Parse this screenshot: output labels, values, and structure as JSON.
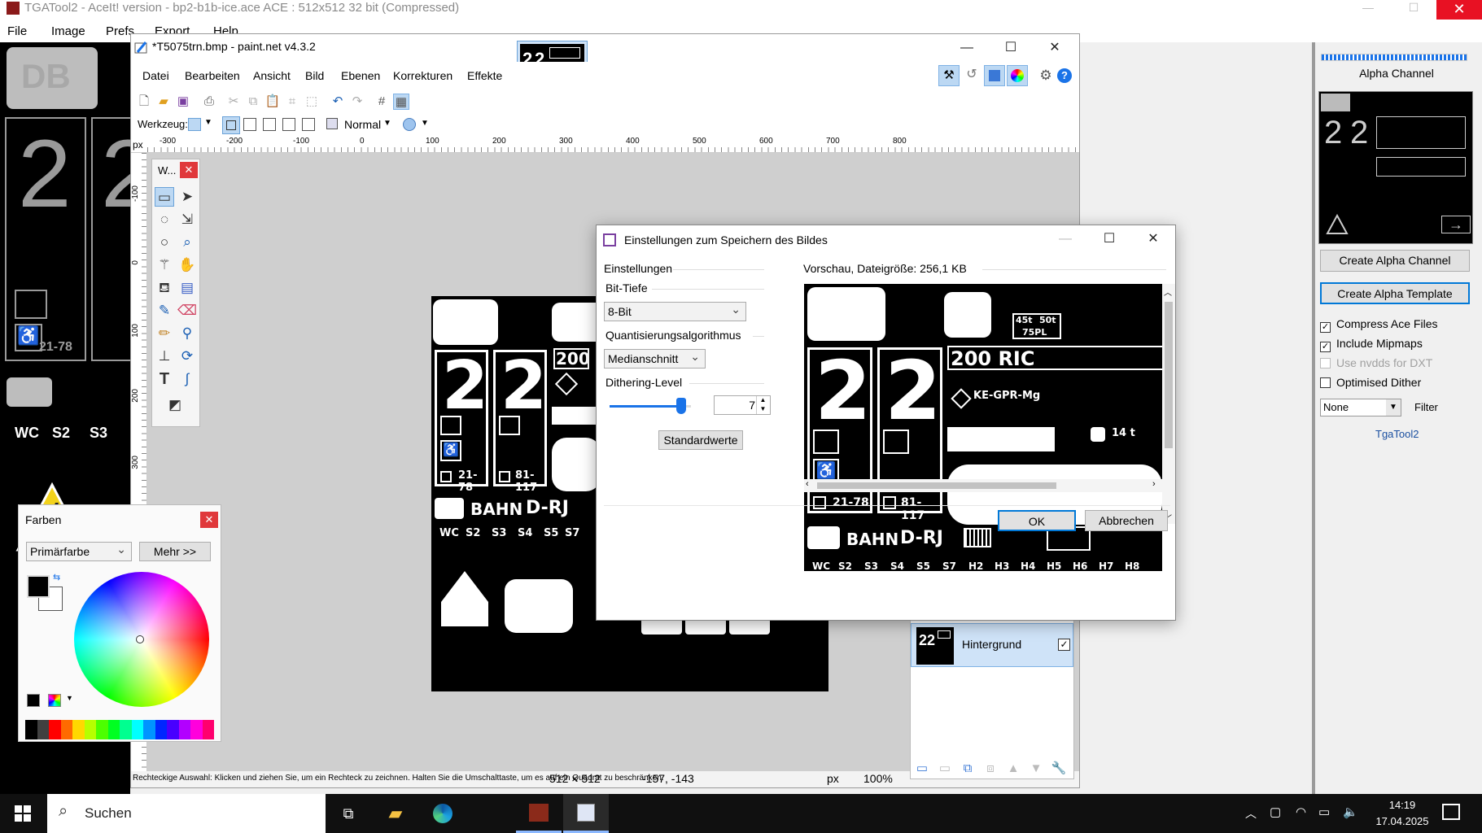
{
  "tga": {
    "title": "TGATool2 - AceIt! version - bp2-b1b-ice.ace   ACE : 512x512 32 bit (Compressed)",
    "menu": [
      "File",
      "Image",
      "Prefs",
      "Export",
      "Help"
    ],
    "panel": {
      "alpha_label": "Alpha Channel",
      "create_alpha_channel": "Create Alpha Channel",
      "create_alpha_template": "Create Alpha Template",
      "checks": [
        {
          "label": "Compress Ace Files",
          "checked": true,
          "enabled": true
        },
        {
          "label": "Include Mipmaps",
          "checked": true,
          "enabled": true
        },
        {
          "label": "Use nvdds for DXT",
          "checked": false,
          "enabled": false
        },
        {
          "label": "Optimised Dither",
          "checked": false,
          "enabled": true
        }
      ],
      "filter_value": "None",
      "filter_label": "Filter",
      "brand": "TgaTool2"
    },
    "canvas_labels": {
      "num": "2",
      "sub_left": "21-78",
      "wc": "WC",
      "s2": "S2",
      "s3": "S3",
      "db": "DB"
    }
  },
  "pdn": {
    "title": "*T5075trn.bmp - paint.net v4.3.2",
    "menu": [
      "Datei",
      "Bearbeiten",
      "Ansicht",
      "Bild",
      "Ebenen",
      "Korrekturen",
      "Effekte"
    ],
    "werkzeug_label": "Werkzeug:",
    "blend_mode": "Normal",
    "ruler_unit": "px",
    "ruler_h": [
      "-300",
      "-200",
      "-100",
      "0",
      "100",
      "200",
      "300",
      "400",
      "500",
      "600",
      "700",
      "800"
    ],
    "ruler_v": [
      "-100",
      "0",
      "100",
      "200",
      "300"
    ],
    "tools_title": "W...",
    "status": {
      "hint": "Rechteckige Auswahl: Klicken und ziehen Sie, um ein Rechteck zu zeichnen. Halten Sie die Umschalttaste, um es auf ein Quadrat zu beschränken.",
      "size": "512 × 512",
      "pos": "-157, -143",
      "unit": "px",
      "zoom": "100%"
    },
    "layer_name": "Hintergrund"
  },
  "image": {
    "big_num": "2",
    "codes": [
      "21-78",
      "81-117"
    ],
    "bahn": "BAHN",
    "drj": "D-RJ",
    "labels": [
      "WC",
      "S2",
      "S3",
      "S4",
      "S5",
      "S7"
    ],
    "n200": "200",
    "ric": "200 RIC",
    "ke": "KE-GPR-Mg",
    "w14": "14 t",
    "w45": "45t",
    "w50": "50t",
    "w75": "75PL",
    "preview_labels": [
      "WC",
      "S2",
      "S3",
      "S4",
      "S5",
      "S7",
      "H2",
      "H3",
      "H4",
      "H5",
      "H6",
      "H7",
      "H8"
    ]
  },
  "farben": {
    "title": "Farben",
    "primary": "Primärfarbe",
    "more": "Mehr >>",
    "palette": [
      "#000000",
      "#404040",
      "#ff0000",
      "#ff6a00",
      "#ffd800",
      "#b6ff00",
      "#4cff00",
      "#00ff21",
      "#00ff90",
      "#00ffff",
      "#0094ff",
      "#0026ff",
      "#4800ff",
      "#b200ff",
      "#ff00dc",
      "#ff006e"
    ]
  },
  "dialog": {
    "title": "Einstellungen zum Speichern des Bildes",
    "settings": "Einstellungen",
    "bit_depth_label": "Bit-Tiefe",
    "bit_depth": "8-Bit",
    "quant_label": "Quantisierungsalgorithmus",
    "quant": "Medianschnitt",
    "dither_label": "Dithering-Level",
    "dither_value": "7",
    "dither_fraction": 0.88,
    "defaults": "Standardwerte",
    "preview": "Vorschau, Dateigröße: 256,1 KB",
    "ok": "OK",
    "cancel": "Abbrechen"
  },
  "taskbar": {
    "search": "Suchen",
    "time": "14:19",
    "date": "17.04.2025"
  }
}
